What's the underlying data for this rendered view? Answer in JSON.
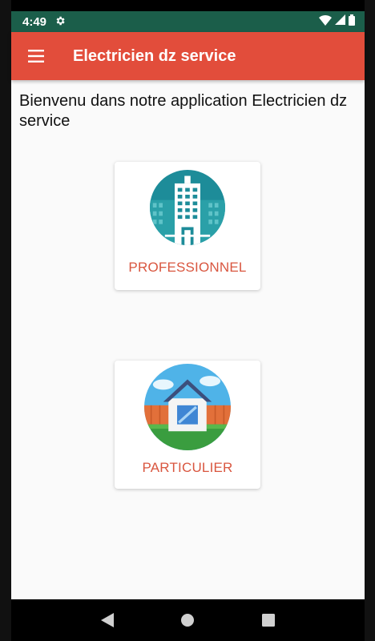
{
  "status_bar": {
    "time": "4:49",
    "settings_icon": "gear-icon",
    "wifi_icon": "wifi-icon",
    "signal_icon": "signal-icon",
    "battery_icon": "battery-icon"
  },
  "app_bar": {
    "menu_icon": "hamburger-menu-icon",
    "title": "Electricien dz service",
    "color": "#e24d3b"
  },
  "main": {
    "welcome_text": "Bienvenu dans notre application Electricien dz service",
    "options": [
      {
        "label": "PROFESSIONNEL",
        "icon": "office-building-icon"
      },
      {
        "label": "PARTICULIER",
        "icon": "house-icon"
      }
    ],
    "accent_text_color": "#d9563f"
  },
  "nav_bar": {
    "back_icon": "back-triangle-icon",
    "home_icon": "home-circle-icon",
    "recents_icon": "recents-square-icon"
  }
}
